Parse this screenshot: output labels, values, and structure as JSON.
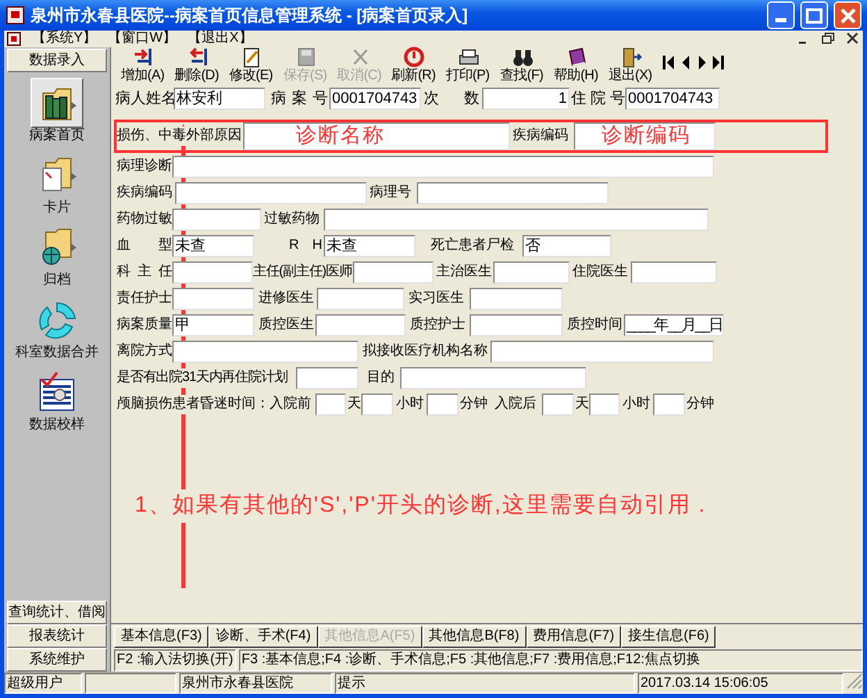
{
  "window": {
    "title": "泉州市永春县医院--病案首页信息管理系统 - [病案首页录入]"
  },
  "menu": [
    "【系统Y】",
    "【窗口W】",
    "【退出X】"
  ],
  "sidebar": {
    "header": "数据录入",
    "items": [
      {
        "label": "病案首页",
        "selected": true
      },
      {
        "label": "卡片",
        "selected": false
      },
      {
        "label": "归档",
        "selected": false
      },
      {
        "label": "科室数据合并",
        "selected": false
      },
      {
        "label": "数据校样",
        "selected": false
      }
    ],
    "bottom_buttons": [
      "查询统计、借阅",
      "报表统计",
      "系统维护"
    ]
  },
  "toolbar": [
    {
      "label": "增加(A)",
      "disabled": false
    },
    {
      "label": "删除(D)",
      "disabled": false
    },
    {
      "label": "修改(E)",
      "disabled": false
    },
    {
      "label": "保存(S)",
      "disabled": true
    },
    {
      "label": "取消(C)",
      "disabled": true
    },
    {
      "label": "刷新(R)",
      "disabled": false
    },
    {
      "label": "打印(P)",
      "disabled": false
    },
    {
      "label": "查找(F)",
      "disabled": false
    },
    {
      "label": "帮助(H)",
      "disabled": false
    },
    {
      "label": "退出(X)",
      "disabled": false
    }
  ],
  "patient": [
    {
      "label": "病人姓名",
      "value": "林安利"
    },
    {
      "label": "病 案 号",
      "value": "0001704743"
    },
    {
      "label": "次 数",
      "value": "1"
    },
    {
      "label": "住 院 号",
      "value": "0001704743"
    }
  ],
  "form": {
    "rows": [
      {
        "highlighted": true,
        "items": [
          {
            "kind": "label",
            "text": "损伤、中毒外部原因"
          },
          {
            "kind": "field",
            "note": "诊断名称"
          },
          {
            "kind": "label",
            "text": "疾病编码"
          },
          {
            "kind": "field",
            "note": "诊断编码"
          }
        ]
      },
      {
        "highlighted": false,
        "items": [
          {
            "kind": "label",
            "text": "病理诊断"
          },
          {
            "kind": "field"
          }
        ]
      },
      {
        "highlighted": false,
        "items": [
          {
            "kind": "label",
            "text": "疾病编码"
          },
          {
            "kind": "field"
          },
          {
            "kind": "label",
            "text": "病理号"
          },
          {
            "kind": "field"
          }
        ]
      },
      {
        "highlighted": false,
        "items": [
          {
            "kind": "label",
            "text": "药物过敏"
          },
          {
            "kind": "field"
          },
          {
            "kind": "label",
            "text": "过敏药物"
          },
          {
            "kind": "field"
          }
        ]
      },
      {
        "highlighted": false,
        "items": [
          {
            "kind": "label",
            "text": "血 型"
          },
          {
            "kind": "field",
            "value": "未查"
          },
          {
            "kind": "label",
            "text": "R H"
          },
          {
            "kind": "field",
            "value": "未查"
          },
          {
            "kind": "label",
            "text": "死亡患者尸检"
          },
          {
            "kind": "field",
            "value": "否"
          }
        ]
      },
      {
        "highlighted": false,
        "items": [
          {
            "kind": "label",
            "text": "科 主 任"
          },
          {
            "kind": "field"
          },
          {
            "kind": "label",
            "text": "主任(副主任)医师"
          },
          {
            "kind": "field"
          },
          {
            "kind": "label",
            "text": "主治医生"
          },
          {
            "kind": "field"
          },
          {
            "kind": "label",
            "text": "住院医生"
          },
          {
            "kind": "field"
          }
        ]
      },
      {
        "highlighted": false,
        "items": [
          {
            "kind": "label",
            "text": "责任护士"
          },
          {
            "kind": "field"
          },
          {
            "kind": "label",
            "text": "进修医生"
          },
          {
            "kind": "field"
          },
          {
            "kind": "label",
            "text": "实习医生"
          },
          {
            "kind": "field"
          }
        ]
      },
      {
        "highlighted": false,
        "items": [
          {
            "kind": "label",
            "text": "病案质量"
          },
          {
            "kind": "field",
            "value": "甲"
          },
          {
            "kind": "label",
            "text": "质控医生"
          },
          {
            "kind": "field"
          },
          {
            "kind": "label",
            "text": "质控护士"
          },
          {
            "kind": "field"
          },
          {
            "kind": "label",
            "text": "质控时间"
          },
          {
            "kind": "field",
            "value": "____年__月__日"
          }
        ]
      },
      {
        "highlighted": false,
        "items": [
          {
            "kind": "label",
            "text": "离院方式"
          },
          {
            "kind": "field"
          },
          {
            "kind": "label",
            "text": "拟接收医疗机构名称"
          },
          {
            "kind": "field"
          }
        ]
      },
      {
        "highlighted": false,
        "items": [
          {
            "kind": "label",
            "text": "是否有出院31天内再住院计划"
          },
          {
            "kind": "field"
          },
          {
            "kind": "label",
            "text": "目的"
          },
          {
            "kind": "field"
          }
        ]
      },
      {
        "highlighted": false,
        "items": [
          {
            "kind": "label",
            "text": "颅脑损伤患者昏迷时间：入院前"
          },
          {
            "kind": "field"
          },
          {
            "kind": "label",
            "text": "天"
          },
          {
            "kind": "field"
          },
          {
            "kind": "label",
            "text": "小时"
          },
          {
            "kind": "field"
          },
          {
            "kind": "label",
            "text": "分钟"
          },
          {
            "kind": "label",
            "text": "入院后"
          },
          {
            "kind": "field"
          },
          {
            "kind": "label",
            "text": "天"
          },
          {
            "kind": "field"
          },
          {
            "kind": "label",
            "text": "小时"
          },
          {
            "kind": "field"
          },
          {
            "kind": "label",
            "text": "分钟"
          }
        ]
      }
    ]
  },
  "annotation": {
    "text": "1、如果有其他的'S','P'开头的诊断,这里需要自动引用 ."
  },
  "tabs": [
    {
      "label": "基本信息(F3)",
      "disabled": false
    },
    {
      "label": "诊断、手术(F4)",
      "disabled": false
    },
    {
      "label": "其他信息A(F5)",
      "disabled": true
    },
    {
      "label": "其他信息B(F8)",
      "disabled": false
    },
    {
      "label": "费用信息(F7)",
      "disabled": false
    },
    {
      "label": "接生信息(F6)",
      "disabled": false
    }
  ],
  "hint_bar": [
    "F2 :输入法切换(开)",
    "F3 :基本信息;F4 :诊断、手术信息;F5 :其他信息;F7 :费用信息;F12:焦点切换"
  ],
  "status_bar": [
    "超级用户",
    "泉州市永春县医院",
    "提示",
    "2017.03.14 15:06:05"
  ]
}
